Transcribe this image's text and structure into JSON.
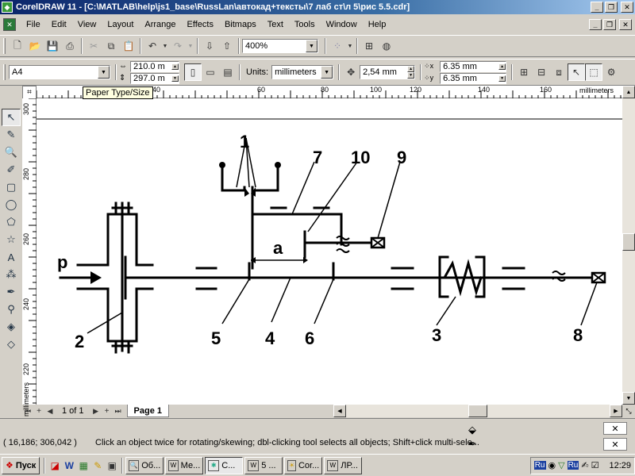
{
  "window": {
    "title": "CorelDRAW 11 - [C:\\MATLAB\\help\\js1_base\\RussLan\\автокад+тексты\\7 лаб ст\\л 5\\рис 5.5.cdr]",
    "minimize": "_",
    "restore": "❐",
    "close": "✕"
  },
  "menu": {
    "items": [
      "File",
      "Edit",
      "View",
      "Layout",
      "Arrange",
      "Effects",
      "Bitmaps",
      "Text",
      "Tools",
      "Window",
      "Help"
    ]
  },
  "toolbar": {
    "zoom_value": "400%"
  },
  "propertybar": {
    "paper_type": "A4",
    "width": "210.0 m",
    "height": "297.0 m",
    "units_label": "Units:",
    "units_value": "millimeters",
    "nudge": "2,54 mm",
    "dup_x": "6.35 mm",
    "dup_y": "6.35 mm"
  },
  "tooltip": "Paper Type/Size",
  "rulers": {
    "h_ticks": [
      "40",
      "60",
      "80",
      "100",
      "120",
      "140",
      "160"
    ],
    "h_unit": "millimeters",
    "v_ticks": [
      "300",
      "280",
      "260",
      "240",
      "220"
    ],
    "v_unit": "millimeters"
  },
  "drawing": {
    "labels": [
      "1",
      "7",
      "10",
      "9",
      "p",
      "a",
      "2",
      "5",
      "4",
      "6",
      "3",
      "8"
    ]
  },
  "pagebar": {
    "page_counter": "1 of 1",
    "page_tab": "Page 1"
  },
  "status": {
    "coords": "( 16,186; 306,042 )",
    "hint": "Click an object twice for rotating/skewing; dbl-clicking tool selects all objects; Shift+click multi-sele..."
  },
  "taskbar": {
    "start": "Пуск",
    "tasks": [
      "Об...",
      "Ме...",
      "C...",
      "5 ...",
      "Cor...",
      "ЛР..."
    ],
    "lang1": "Ru",
    "lang2": "Ru",
    "clock": "12:29"
  },
  "colors": {
    "title_start": "#0a246a",
    "title_end": "#a6caf0",
    "chrome": "#d4d0c8"
  }
}
